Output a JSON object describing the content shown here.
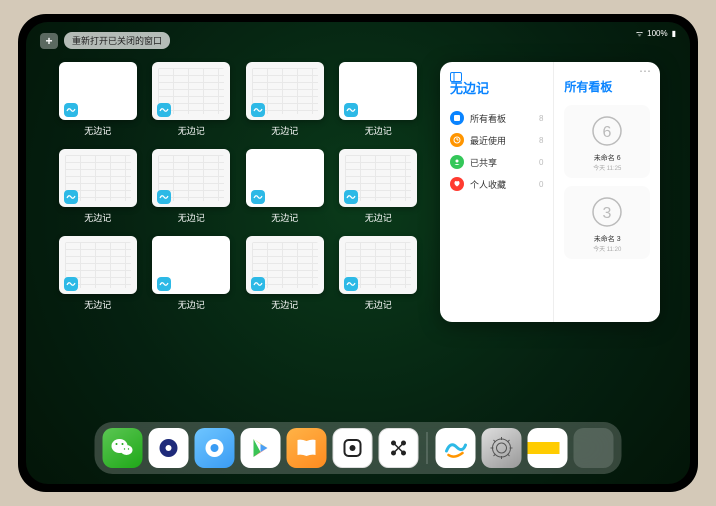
{
  "status": {
    "battery": "100%",
    "wifi": "􀙇"
  },
  "topbar": {
    "plus": "+",
    "reopen": "重新打开已关闭的窗口"
  },
  "app_label": "无边记",
  "thumbnails": [
    {
      "variant": "plain"
    },
    {
      "variant": "alt"
    },
    {
      "variant": "alt"
    },
    {
      "variant": "plain"
    },
    {
      "variant": "alt"
    },
    {
      "variant": "alt"
    },
    {
      "variant": "plain"
    },
    {
      "variant": "alt"
    },
    {
      "variant": "alt"
    },
    {
      "variant": "plain"
    },
    {
      "variant": "alt"
    },
    {
      "variant": "alt"
    }
  ],
  "sidepanel": {
    "title": "无边记",
    "right_title": "所有看板",
    "rows": [
      {
        "icon_color": "#0a84ff",
        "label": "所有看板",
        "count": "8"
      },
      {
        "icon_color": "#ff9500",
        "label": "最近使用",
        "count": "8"
      },
      {
        "icon_color": "#34c759",
        "label": "已共享",
        "count": "0"
      },
      {
        "icon_color": "#ff3b30",
        "label": "个人收藏",
        "count": "0"
      }
    ],
    "boards": [
      {
        "name": "未命名 6",
        "date": "今天 11:25",
        "digit": "6"
      },
      {
        "name": "未命名 3",
        "date": "今天 11:20",
        "digit": "3"
      }
    ]
  },
  "dock": {
    "apps": [
      {
        "name": "wechat"
      },
      {
        "name": "quark"
      },
      {
        "name": "browser"
      },
      {
        "name": "play"
      },
      {
        "name": "books"
      },
      {
        "name": "dice"
      },
      {
        "name": "dots"
      }
    ],
    "recents": [
      {
        "name": "freeform"
      },
      {
        "name": "settings"
      },
      {
        "name": "notes"
      },
      {
        "name": "app-library"
      }
    ]
  }
}
